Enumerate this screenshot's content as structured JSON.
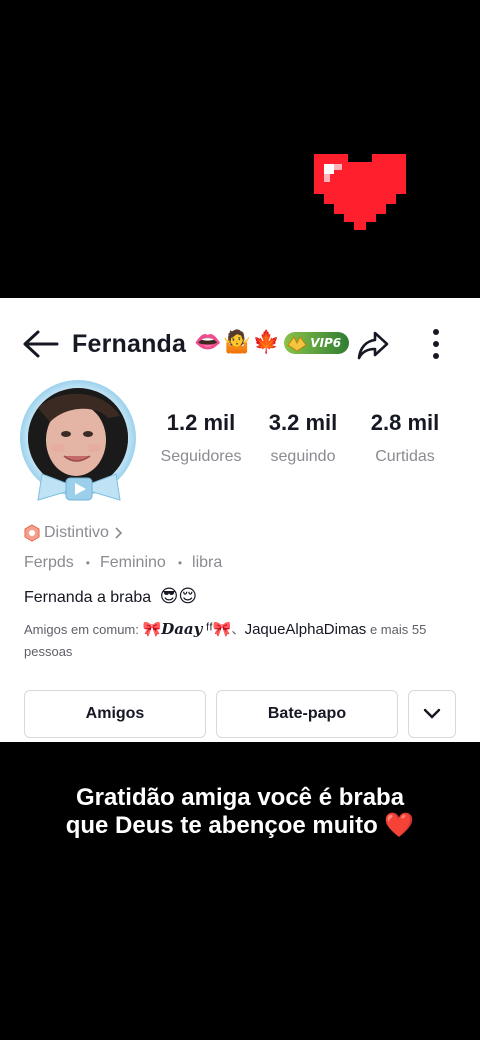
{
  "profile": {
    "name": "Fernanda",
    "emojis": [
      "👄",
      "🤷",
      "🍁"
    ],
    "vip_label": "VIP6",
    "stats": [
      {
        "value": "1.2 mil",
        "label": "Seguidores"
      },
      {
        "value": "3.2 mil",
        "label": "seguindo"
      },
      {
        "value": "2.8 mil",
        "label": "Curtidas"
      }
    ],
    "badge_label": "Distintivo",
    "username": "Ferpds",
    "gender": "Feminino",
    "sign": "libra",
    "bio": "Fernanda a braba",
    "bio_emojis": "😎😌",
    "mutual_prefix": "Amigos em comum:",
    "mutual_friend1": "Daay",
    "mutual_friend1_suffix": "ᶠᶠ",
    "mutual_friend2": "JaqueAlphaDimas",
    "mutual_suffix": "e mais 55 pessoas",
    "buttons": {
      "friends": "Amigos",
      "chat": "Bate-papo"
    }
  },
  "caption": {
    "line1": "Gratidão amiga  você é braba",
    "line2": "que Deus te abençoe muito",
    "heart": "❤️"
  },
  "colors": {
    "heart_red": "#ff1f2d",
    "muted_text": "#8a8b91",
    "vip_green": "#4caf50"
  }
}
